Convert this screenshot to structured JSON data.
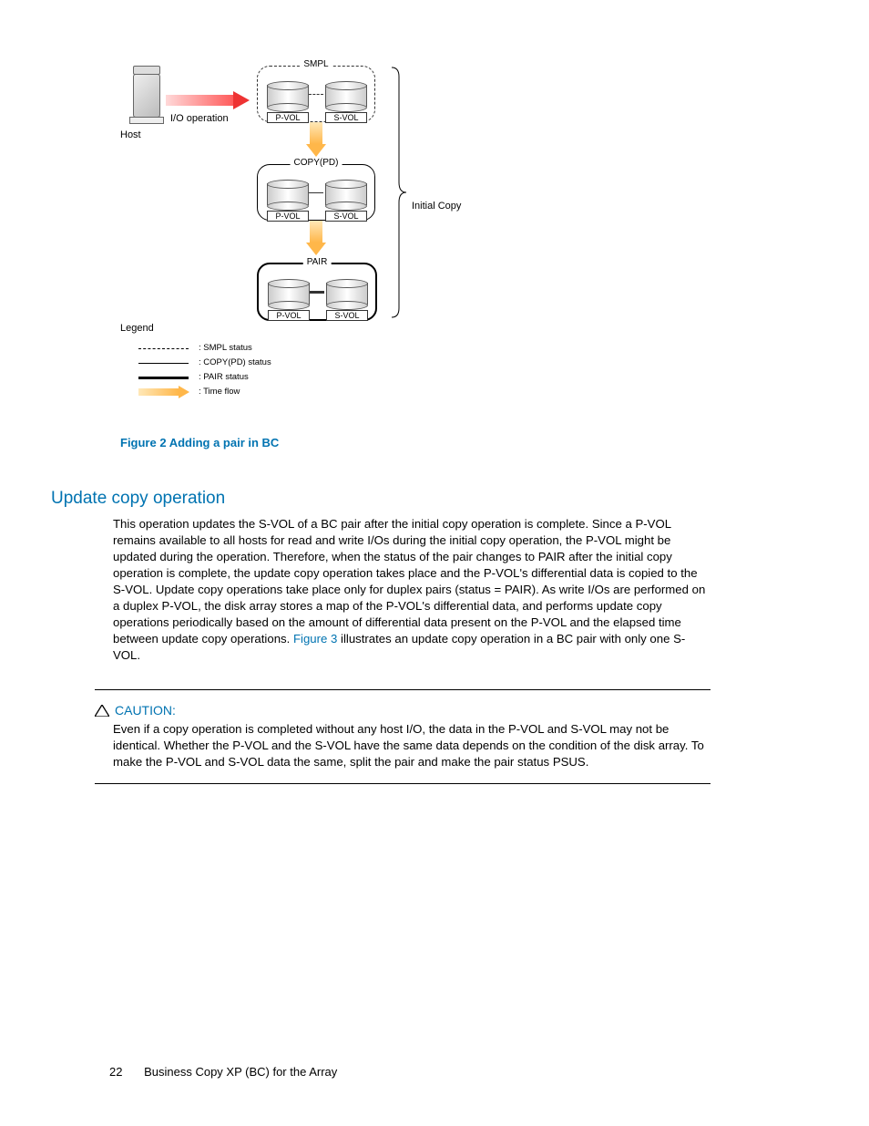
{
  "diagram": {
    "host_label": "Host",
    "io_label": "I/O operation",
    "brace_label": "Initial Copy",
    "legend_title": "Legend",
    "states": {
      "smpl": {
        "title": "SMPL",
        "pvol": "P-VOL",
        "svol": "S-VOL"
      },
      "copypd": {
        "title": "COPY(PD)",
        "pvol": "P-VOL",
        "svol": "S-VOL"
      },
      "pair": {
        "title": "PAIR",
        "pvol": "P-VOL",
        "svol": "S-VOL"
      }
    },
    "legend_items": {
      "smpl": ": SMPL status",
      "copypd": ": COPY(PD) status",
      "pair": ": PAIR status",
      "flow": ": Time flow"
    }
  },
  "figure_caption": "Figure 2 Adding a pair in BC",
  "section_heading": "Update copy operation",
  "body_text_1": "This operation updates the S-VOL of a BC pair after the initial copy operation is complete. Since a P-VOL remains available to all hosts for read and write I/Os during the initial copy operation, the P-VOL might be updated during the operation. Therefore, when the status of the pair changes to PAIR after the initial copy operation is complete, the update copy operation takes place and the P-VOL's differential data is copied to the S-VOL. Update copy operations take place only for duplex pairs (status = PAIR). As write I/Os are performed on a duplex P-VOL, the disk array stores a map of the P-VOL's differential data, and performs update copy operations periodically based on the amount of differential data present on the P-VOL and the elapsed time between update copy operations. ",
  "body_link": "Figure 3",
  "body_text_2": " illustrates an update copy operation in a BC pair with only one S-VOL.",
  "caution_label": "CAUTION:",
  "caution_text": "Even if a copy operation is completed without any host I/O, the data in the P-VOL and S-VOL may not be identical. Whether the P-VOL and the S-VOL have the same data depends on the condition of the disk array. To make the P-VOL and S-VOL data the same, split the pair and make the pair status PSUS.",
  "footer_page": "22",
  "footer_text": "Business Copy XP (BC) for the Array"
}
